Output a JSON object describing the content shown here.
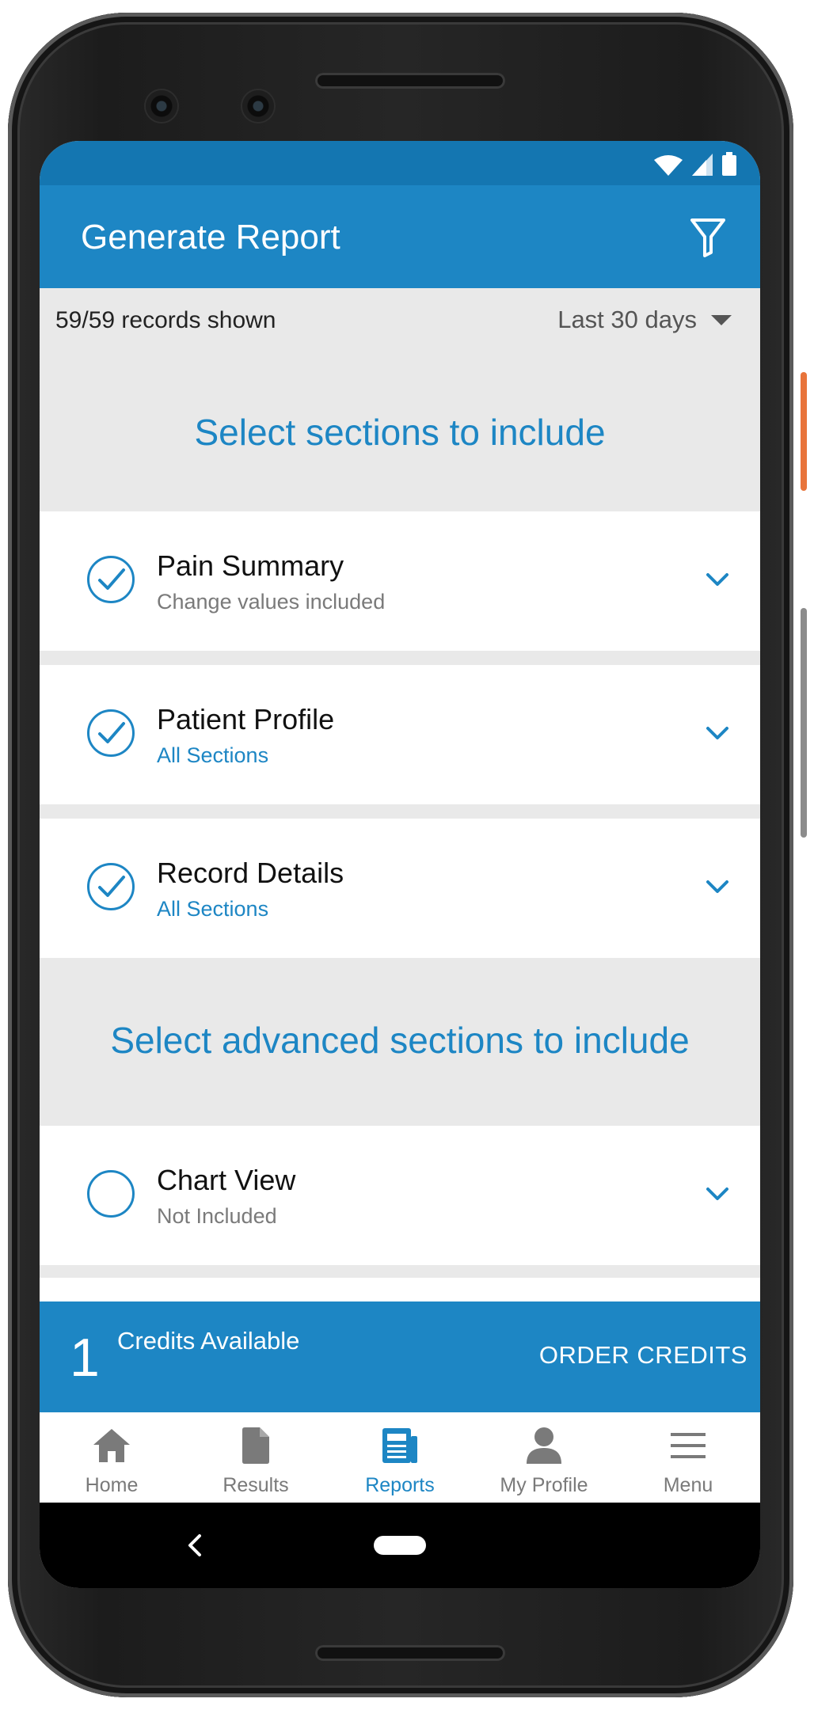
{
  "app": {
    "title": "Generate Report",
    "filter_icon": "filter-funnel-icon",
    "accent_color": "#1d86c4",
    "status_bar_color": "#1476b1"
  },
  "status_bar": {
    "icons": [
      "wifi-icon",
      "cell-signal-icon",
      "battery-icon"
    ]
  },
  "records": {
    "count_text": "59/59 records shown",
    "date_range": "Last 30 days"
  },
  "sections": {
    "heading": "Select sections to include",
    "items": [
      {
        "title": "Pain Summary",
        "subtitle": "Change values included",
        "checked": true
      },
      {
        "title": "Patient Profile",
        "subtitle": "All Sections",
        "checked": true
      },
      {
        "title": "Record Details",
        "subtitle": "All Sections",
        "checked": true
      }
    ]
  },
  "advanced_sections": {
    "heading": "Select advanced sections to include",
    "items": [
      {
        "title": "Chart View",
        "subtitle": "Not Included",
        "checked": false
      }
    ]
  },
  "credits": {
    "count": "1",
    "label": "Credits Available",
    "order_button": "ORDER CREDITS"
  },
  "bottom_nav": {
    "items": [
      {
        "label": "Home",
        "icon": "home-icon",
        "active": false
      },
      {
        "label": "Results",
        "icon": "document-icon",
        "active": false
      },
      {
        "label": "Reports",
        "icon": "report-icon",
        "active": true
      },
      {
        "label": "My Profile",
        "icon": "person-icon",
        "active": false
      },
      {
        "label": "Menu",
        "icon": "hamburger-menu-icon",
        "active": false
      }
    ]
  }
}
